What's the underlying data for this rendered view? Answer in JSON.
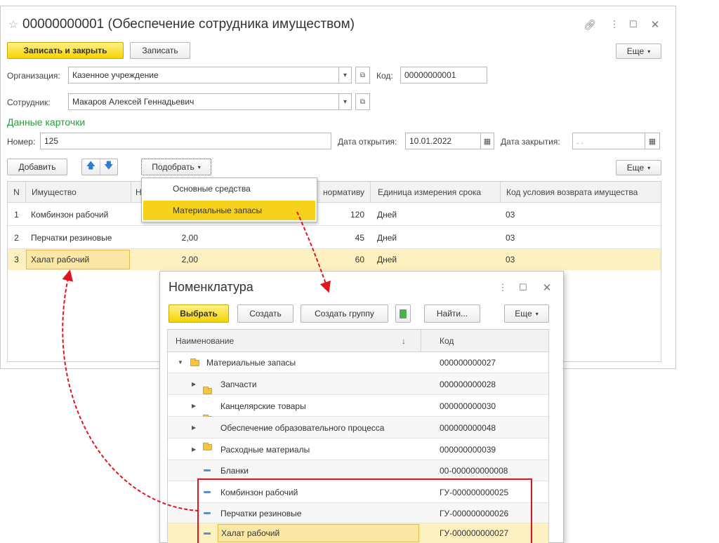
{
  "main": {
    "title": "00000000001 (Обеспечение сотрудника имуществом)",
    "buttons": {
      "save_close": "Записать и закрыть",
      "save": "Записать",
      "more": "Еще"
    },
    "org_label": "Организация:",
    "org_value": "Казенное учреждение",
    "code_label": "Код:",
    "code_value": "00000000001",
    "employee_label": "Сотрудник:",
    "employee_value": "Макаров Алексей Геннадьевич",
    "section_title": "Данные карточки",
    "number_label": "Номер:",
    "number_value": "125",
    "open_date_label": "Дата открытия:",
    "open_date_value": "10.01.2022",
    "close_date_label": "Дата закрытия:",
    "close_date_value": ". .",
    "add_button": "Добавить",
    "pick_button": "Подобрать",
    "more_table": "Еще"
  },
  "table": {
    "headers": [
      "N",
      "Имущество",
      "Н",
      "нормативу",
      "Единица измерения срока",
      "Код условия возврата имущества"
    ],
    "rows": [
      {
        "n": "1",
        "name": "Комбинзон рабочий",
        "qty": "",
        "norm": "120",
        "unit": "Дней",
        "code": "03"
      },
      {
        "n": "2",
        "name": "Перчатки резиновые",
        "qty": "2,00",
        "norm": "45",
        "unit": "Дней",
        "code": "03"
      },
      {
        "n": "3",
        "name": "Халат рабочий",
        "qty": "2,00",
        "norm": "60",
        "unit": "Дней",
        "code": "03"
      }
    ]
  },
  "pick_menu": {
    "items": [
      "Основные средства",
      "Материальные запасы"
    ]
  },
  "nomen": {
    "title": "Номенклатура",
    "buttons": {
      "select": "Выбрать",
      "create": "Создать",
      "create_group": "Создать группу",
      "find": "Найти...",
      "more": "Еще"
    },
    "col_name": "Наименование",
    "col_code": "Код",
    "sort_arrow": "↓",
    "rows": [
      {
        "name": "Материальные запасы",
        "code": "000000000027"
      },
      {
        "name": "Запчасти",
        "code": "000000000028"
      },
      {
        "name": "Канцелярские товары",
        "code": "000000000030"
      },
      {
        "name": "Обеспечение образовательного процесса",
        "code": "000000000048"
      },
      {
        "name": "Расходные материалы",
        "code": "000000000039"
      },
      {
        "name": "Бланки",
        "code": "00-000000000008"
      },
      {
        "name": "Комбинзон рабочий",
        "code": "ГУ-000000000025"
      },
      {
        "name": "Перчатки резиновые",
        "code": "ГУ-000000000026"
      },
      {
        "name": "Халат рабочий",
        "code": "ГУ-000000000027"
      }
    ]
  },
  "colors": {
    "accent_yellow": "#f5d400",
    "highlight_row": "#fdf1c2",
    "red": "#e0141e",
    "green_section": "#2a9c3e"
  }
}
